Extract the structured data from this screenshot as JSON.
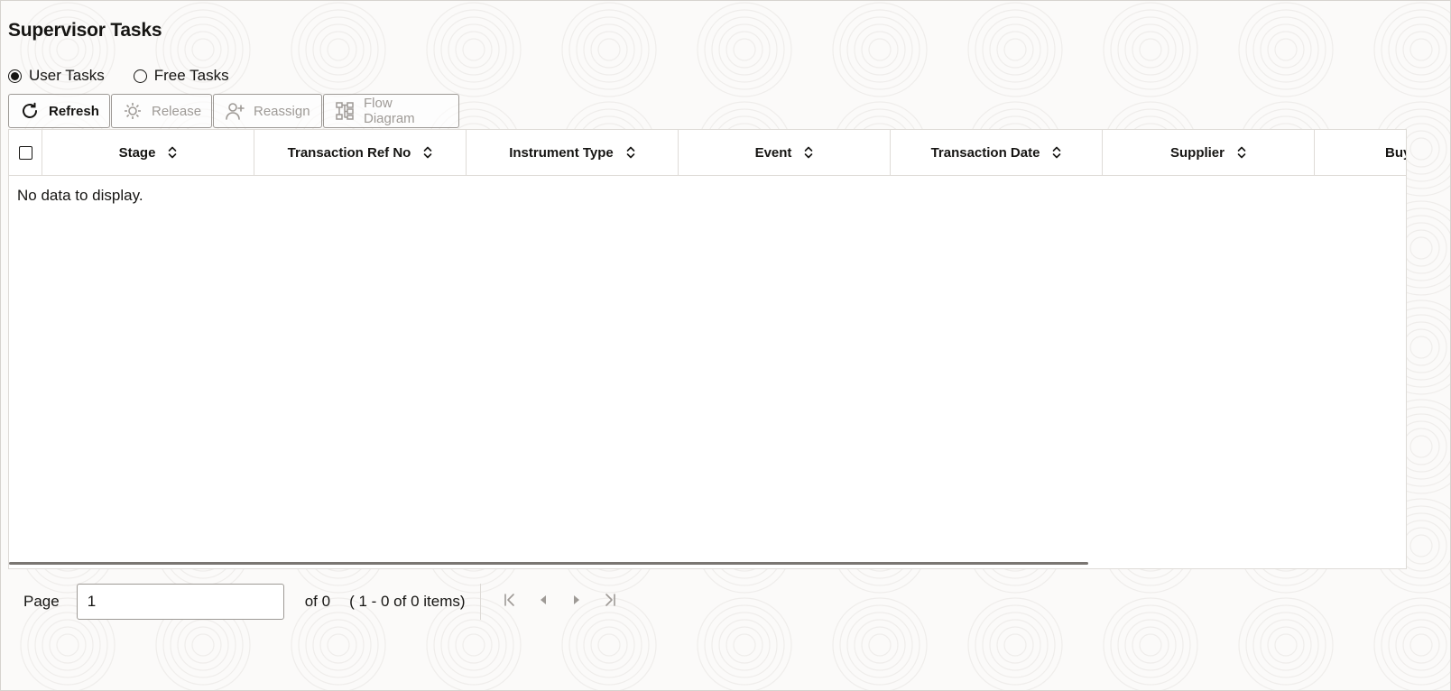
{
  "page": {
    "title": "Supervisor Tasks"
  },
  "task_filter": {
    "options": [
      {
        "label": "User Tasks",
        "selected": true
      },
      {
        "label": "Free Tasks",
        "selected": false
      }
    ]
  },
  "toolbar": {
    "refresh_label": "Refresh",
    "release_label": "Release",
    "reassign_label": "Reassign",
    "flow_diagram_label": "Flow Diagram"
  },
  "grid": {
    "columns": [
      "Stage",
      "Transaction Ref No",
      "Instrument Type",
      "Event",
      "Transaction Date",
      "Supplier",
      "Buy"
    ],
    "rows": [],
    "empty_message": "No data to display."
  },
  "pagination": {
    "page_label": "Page",
    "current_page": "1",
    "of_total": "of 0",
    "items_range": "( 1 - 0 of 0 items)"
  },
  "icons": {
    "refresh": "refresh-icon",
    "release": "release-icon",
    "reassign": "reassign-user-icon",
    "flow_diagram": "flow-diagram-icon",
    "sort": "sort-icon",
    "first_page": "first-page-icon",
    "previous_page": "previous-page-icon",
    "next_page": "next-page-icon",
    "last_page": "last-page-icon"
  },
  "colors": {
    "text": "#161513",
    "disabled_text": "#9e9a96",
    "border": "#dedbd7",
    "background": "#fbfaf9"
  }
}
